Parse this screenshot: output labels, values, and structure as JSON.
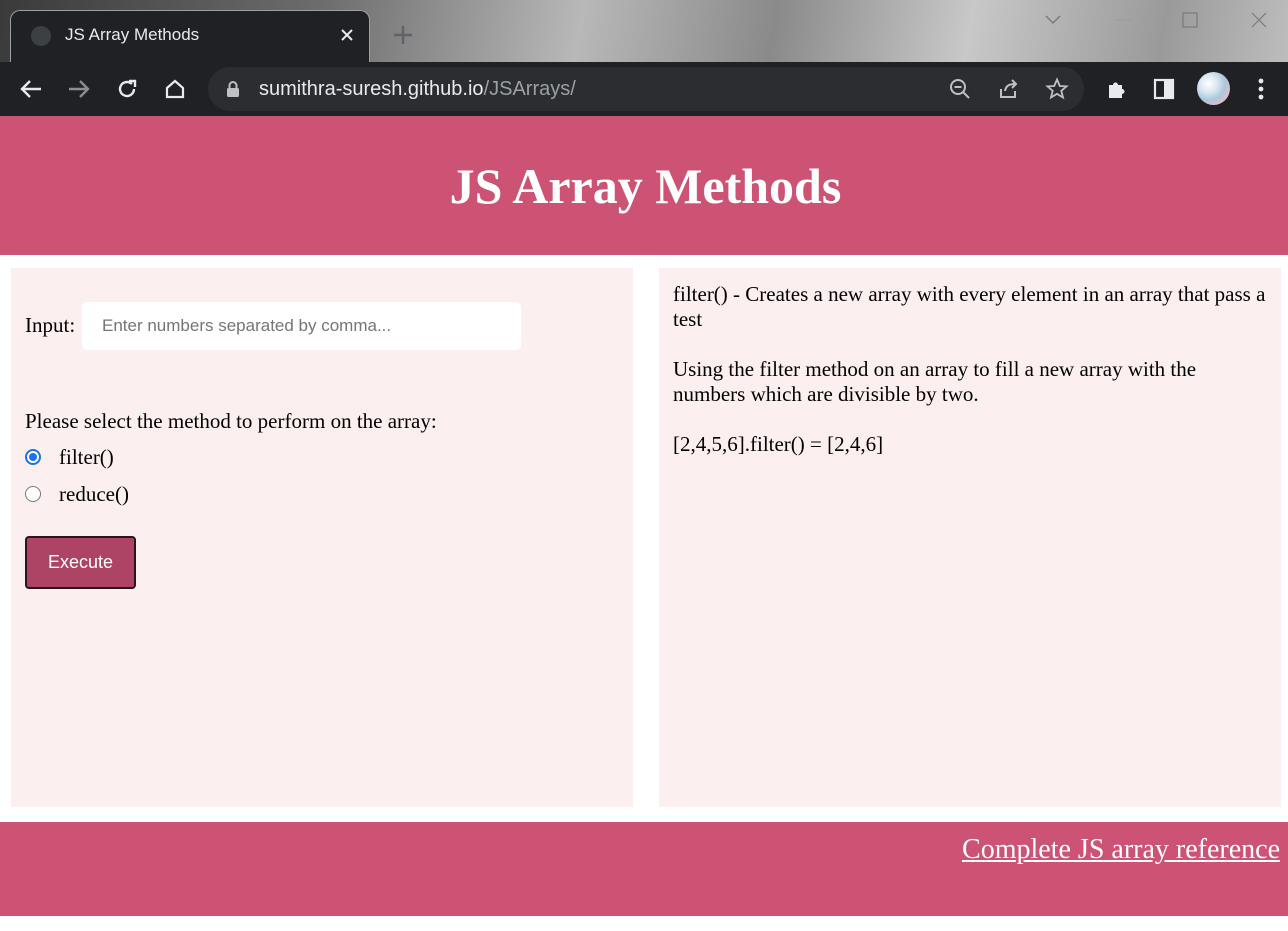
{
  "browser": {
    "tab_title": "JS Array Methods",
    "url_host": "sumithra-suresh.github.io",
    "url_path": "/JSArrays/",
    "icons": [
      "favicon",
      "close-icon",
      "new-tab-icon",
      "chevron-down-icon",
      "minimize-icon",
      "maximize-icon",
      "window-close-icon",
      "back-arrow-icon",
      "forward-arrow-icon",
      "reload-icon",
      "home-icon",
      "lock-icon",
      "zoom-out-icon",
      "share-icon",
      "star-icon",
      "extensions-icon",
      "side-panel-icon",
      "profile-avatar",
      "more-menu-icon"
    ]
  },
  "header": {
    "title": "JS Array Methods",
    "color": "#cd5374"
  },
  "form": {
    "input_label": "Input:",
    "input_value": "",
    "input_placeholder": "Enter numbers separated by comma...",
    "method_prompt": "Please select the method to perform on the array:",
    "options": [
      {
        "label": "filter()",
        "selected": true
      },
      {
        "label": "reduce()",
        "selected": false
      }
    ],
    "execute_label": "Execute",
    "button_color": "#ad4466"
  },
  "description": {
    "line1": "filter() - Creates a new array with every element in an array that pass a test",
    "line2": "Using the filter method on an array to fill a new array with the numbers which are divisible by two.",
    "line3": "[2,4,5,6].filter() = [2,4,6]",
    "panel_color": "#fcefef"
  },
  "footer": {
    "link_text": "Complete JS array reference"
  }
}
